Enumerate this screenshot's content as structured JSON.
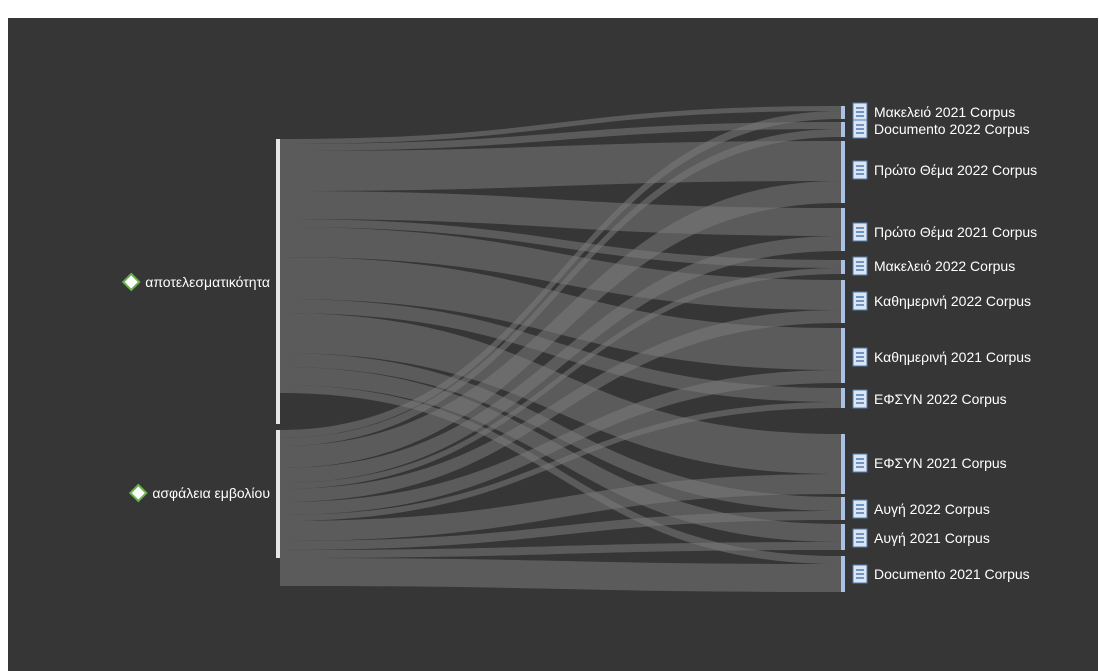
{
  "diagram": {
    "type": "sankey",
    "sources": [
      {
        "id": "s1",
        "label": "αποτελεσματικότητα"
      },
      {
        "id": "s2",
        "label": "ασφάλεια εμβολίου"
      }
    ],
    "targets": [
      {
        "id": "t1",
        "label": "Μακελειό 2021 Corpus"
      },
      {
        "id": "t2",
        "label": "Documento 2022 Corpus"
      },
      {
        "id": "t3",
        "label": "Πρώτο Θέμα 2022 Corpus"
      },
      {
        "id": "t4",
        "label": "Πρώτο Θέμα 2021 Corpus"
      },
      {
        "id": "t5",
        "label": "Μακελειό 2022 Corpus"
      },
      {
        "id": "t6",
        "label": "Καθημερινή 2022 Corpus"
      },
      {
        "id": "t7",
        "label": "Καθημερινή 2021 Corpus"
      },
      {
        "id": "t8",
        "label": "ΕΦΣΥΝ 2022 Corpus"
      },
      {
        "id": "t9",
        "label": "ΕΦΣΥΝ 2021 Corpus"
      },
      {
        "id": "t10",
        "label": "Αυγή 2022 Corpus"
      },
      {
        "id": "t11",
        "label": "Αυγή 2021 Corpus"
      },
      {
        "id": "t12",
        "label": "Documento 2021 Corpus"
      }
    ],
    "colors": {
      "background": "#363636",
      "flow": "#7a7a7a",
      "source_bar": "#e6e6e6",
      "target_bar": "#a9c1e2",
      "diamond_fill": "#ffffff",
      "diamond_stroke": "#6ab04c",
      "doc_icon_fill": "#dce6f2",
      "doc_icon_line": "#4e79b0"
    },
    "icons": {
      "source": "diamond-icon",
      "target": "document-icon"
    }
  }
}
